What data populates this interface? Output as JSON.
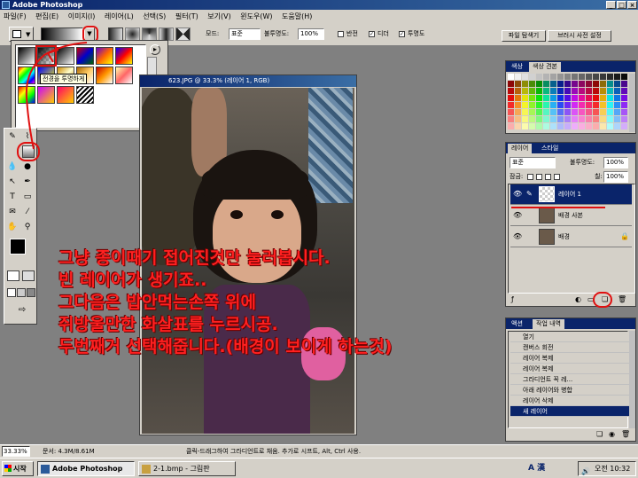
{
  "window": {
    "title": "Adobe Photoshop",
    "controls": [
      "_",
      "□",
      "×"
    ]
  },
  "menu": [
    "파일(F)",
    "편집(E)",
    "이미지(I)",
    "레이어(L)",
    "선택(S)",
    "필터(T)",
    "보기(V)",
    "윈도우(W)",
    "도움말(H)"
  ],
  "options": {
    "mode_label": "모드:",
    "mode_value": "표준",
    "opacity_label": "불투명도:",
    "opacity_value": "100%",
    "reverse_label": "반전",
    "dither_label": "디더",
    "transparency_label": "투명도",
    "tab_file_browser": "파일 탐색기",
    "tab_brushes": "브러시 사전 설정"
  },
  "gradient_picker": {
    "tooltip": "전경을 투명하게"
  },
  "document": {
    "title": "623.JPG @ 33.3% (레이어 1, RGB)"
  },
  "swatches_palette": {
    "tabs": [
      "색상",
      "색상 견본"
    ]
  },
  "layers_palette": {
    "tabs": [
      "레이어",
      "스타일"
    ],
    "blend_mode": "표준",
    "opacity_label": "불투명도:",
    "opacity_value": "100%",
    "lock_label": "잠금:",
    "fill_label": "칠:",
    "fill_value": "100%",
    "layers": [
      "레이어 1",
      "배경 사본",
      "배경"
    ]
  },
  "history_palette": {
    "tabs": [
      "액션",
      "작업 내역"
    ],
    "items": [
      "열기",
      "캔버스 회전",
      "레이어 복제",
      "레이어 복제",
      "그라디언트 꼭 레...",
      "아래 레이어와 병합",
      "레이어 삭제",
      "새 레이어"
    ]
  },
  "status": {
    "zoom": "33.33%",
    "doc_info": "문서: 4.3M/8.61M",
    "hint": "클릭-드래그하여 그라디언트로 채움. 추가로 시프트, Alt, Ctrl 사용."
  },
  "taskbar": {
    "start": "시작",
    "tasks": [
      "Adobe Photoshop",
      "2-1.bmp - 그림판"
    ],
    "clock": "오전 10:32",
    "tray_ime": "A 漢"
  },
  "overlay": {
    "lines": [
      "그냥 종이때기 접어진것만 눌러봅시다.",
      "빈 레이어가 생기죠..",
      "그다음은 밥안먹는손쪽 위에",
      "쥐방울만한 화살표를 누르시공.",
      "두번째거 선택해줍니다.(배경이 보이게 하는것)"
    ]
  },
  "colors": {
    "titlebar": "#0a246a",
    "chrome": "#d4d0c8",
    "annotation": "#ff2020",
    "selected_layer": "#0a246a"
  }
}
